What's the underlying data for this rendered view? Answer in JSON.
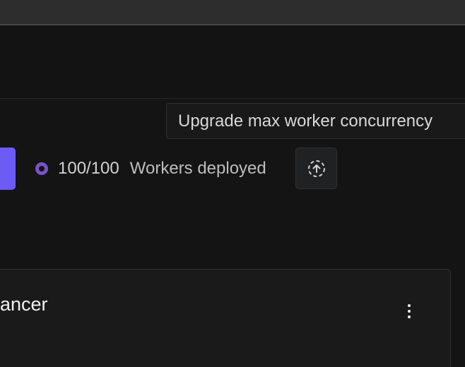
{
  "tooltip": {
    "text": "Upgrade max worker concurrency"
  },
  "workers": {
    "count": "100/100",
    "label": "Workers deployed"
  },
  "card": {
    "title_fragment": "ancer"
  },
  "icons": {
    "status": "ring-icon",
    "upgrade": "upgrade-arrow-icon",
    "menu": "more-vertical-icon"
  },
  "colors": {
    "primary": "#6d5bf5",
    "status_ring": "#7a52c9"
  }
}
